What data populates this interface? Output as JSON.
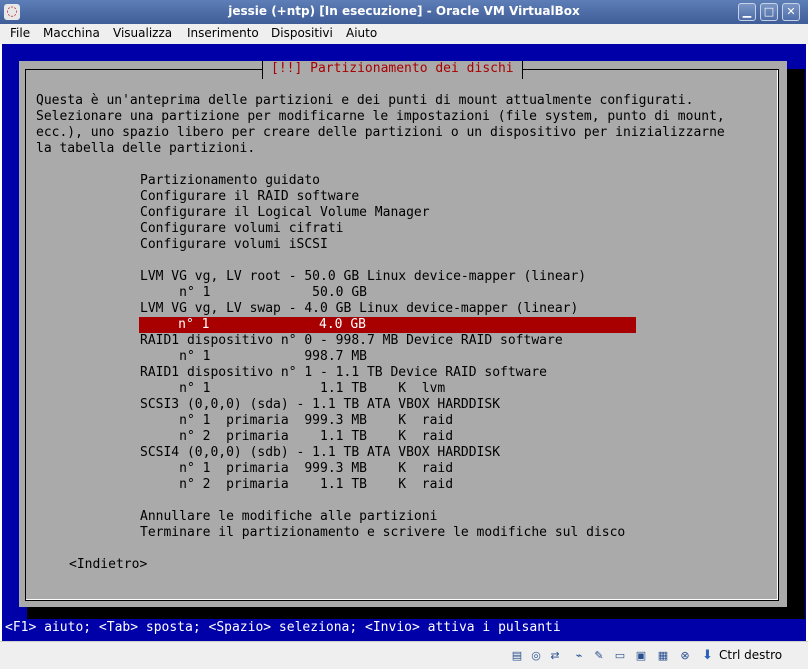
{
  "window": {
    "title": "jessie (+ntp) [In esecuzione] - Oracle VM VirtualBox",
    "app_icon": "virtualbox-icon",
    "controls": [
      "minimize-icon",
      "maximize-icon",
      "close-icon"
    ]
  },
  "menubar": {
    "items": [
      "File",
      "Macchina",
      "Visualizza",
      "Inserimento",
      "Dispositivi",
      "Aiuto"
    ]
  },
  "dialog": {
    "title": "[!!] Partizionamento dei dischi",
    "intro": [
      "Questa è un'anteprima delle partizioni e dei punti di mount attualmente configurati.",
      "Selezionare una partizione per modificarne le impostazioni (file system, punto di mount,",
      "ecc.), uno spazio libero per creare delle partizioni o un dispositivo per inizializzarne",
      "la tabella delle partizioni."
    ],
    "menu_items": [
      "Partizionamento guidato",
      "Configurare il RAID software",
      "Configurare il Logical Volume Manager",
      "Configurare volumi cifrati",
      "Configurare volumi iSCSI"
    ],
    "partitions": [
      "LVM VG vg, LV root - 50.0 GB Linux device-mapper (linear)",
      "     n° 1             50.0 GB",
      "LVM VG vg, LV swap - 4.0 GB Linux device-mapper (linear)",
      "     n° 1              4.0 GB",
      "RAID1 dispositivo n° 0 - 998.7 MB Device RAID software",
      "     n° 1            998.7 MB",
      "RAID1 dispositivo n° 1 - 1.1 TB Device RAID software",
      "     n° 1              1.1 TB    K  lvm",
      "SCSI3 (0,0,0) (sda) - 1.1 TB ATA VBOX HARDDISK",
      "     n° 1  primaria  999.3 MB    K  raid",
      "     n° 2  primaria    1.1 TB    K  raid",
      "SCSI4 (0,0,0) (sdb) - 1.1 TB ATA VBOX HARDDISK",
      "     n° 1  primaria  999.3 MB    K  raid",
      "     n° 2  primaria    1.1 TB    K  raid"
    ],
    "selected_partition_index": 3,
    "actions": [
      "Annullare le modifiche alle partizioni",
      "Terminare il partizionamento e scrivere le modifiche sul disco"
    ],
    "back_button": "<Indietro>"
  },
  "helpline": "<F1> aiuto; <Tab> sposta; <Spazio> seleziona; <Invio> attiva i pulsanti",
  "statusbar": {
    "icons": [
      "hard-disk-icon",
      "optical-disk-icon",
      "network-icon",
      "usb-icon",
      "pencil-icon",
      "shared-folder-icon",
      "display-icon",
      "video-capture-icon",
      "cpu-icon",
      "mouse-integration-icon"
    ],
    "host_key_label": "Ctrl destro"
  }
}
